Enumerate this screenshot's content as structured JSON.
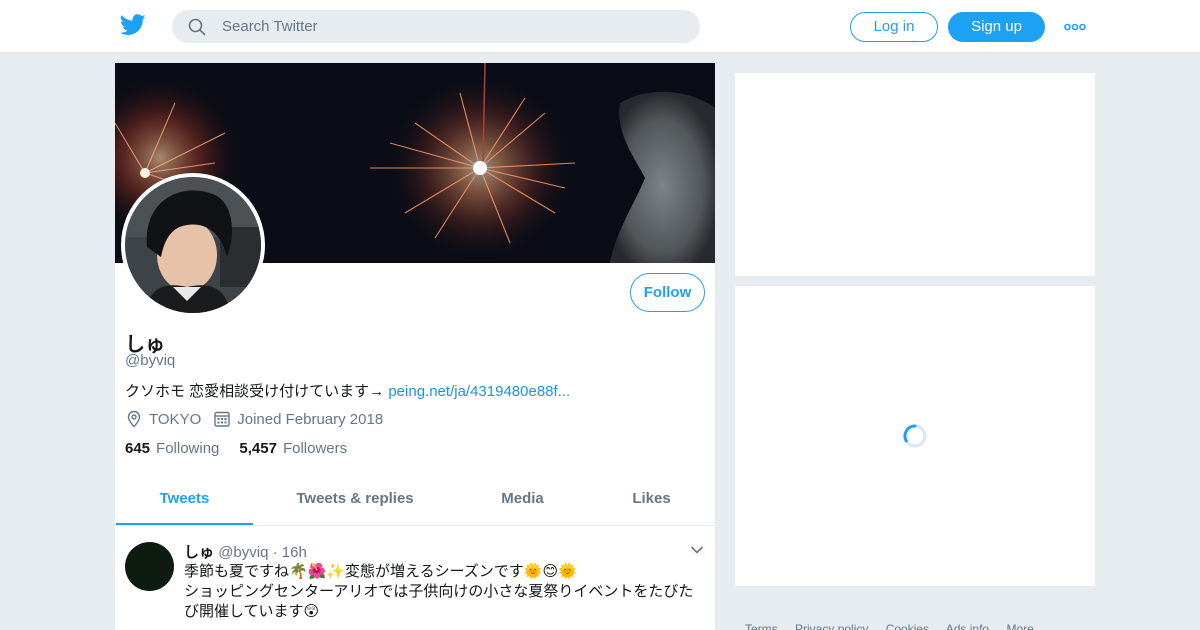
{
  "header": {
    "logo_icon": "twitter-bird-icon",
    "search_placeholder": "Search Twitter",
    "login_label": "Log in",
    "signup_label": "Sign up",
    "more_icon": "more-dots-icon",
    "accent_color": "#1da1f2"
  },
  "profile": {
    "name": "しゅ",
    "handle": "@byviq",
    "bio_text": "クソホモ 恋愛相談受け付けています→ ",
    "bio_link": "peing.net/ja/4319480e88f...",
    "location": "TOKYO",
    "joined": "Joined February 2018",
    "following_count": "645",
    "following_label": "Following",
    "followers_count": "5,457",
    "followers_label": "Followers",
    "follow_label": "Follow"
  },
  "tabs": [
    {
      "label": "Tweets",
      "active": true
    },
    {
      "label": "Tweets & replies",
      "active": false
    },
    {
      "label": "Media",
      "active": false
    },
    {
      "label": "Likes",
      "active": false
    }
  ],
  "tweet": {
    "name": "しゅ",
    "handle": "@byviq",
    "separator": " · ",
    "time": "16h",
    "line1": "季節も夏ですね🌴🌺✨変態が増えるシーズンです🌞😊🌞",
    "line2": "ショッピングセンターアリオでは子供向けの小さな夏祭りイベントをたびたび開催しています😲"
  },
  "footer": {
    "links": [
      "Terms",
      "Privacy policy",
      "Cookies",
      "Ads info",
      "More"
    ]
  }
}
